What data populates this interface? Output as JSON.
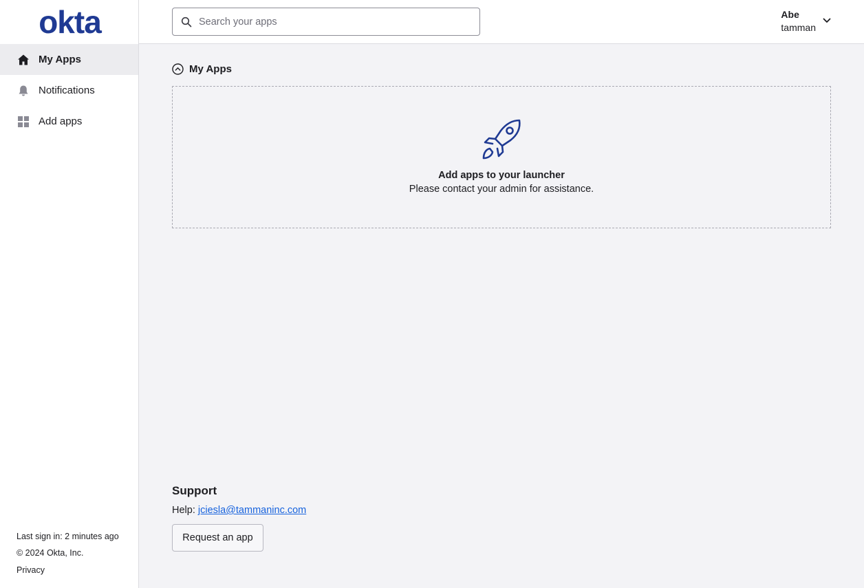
{
  "brand": {
    "logo_text": "okta",
    "color": "#1f3a93"
  },
  "sidebar": {
    "items": [
      {
        "label": "My Apps",
        "icon": "home-icon",
        "active": true
      },
      {
        "label": "Notifications",
        "icon": "bell-icon",
        "active": false
      },
      {
        "label": "Add apps",
        "icon": "grid-icon",
        "active": false
      }
    ],
    "footer": {
      "last_sign_in": "Last sign in: 2 minutes ago",
      "copyright": "© 2024 Okta, Inc.",
      "privacy": "Privacy"
    }
  },
  "header": {
    "search_placeholder": "Search your apps",
    "user_first_name": "Abe",
    "user_org": "tamman"
  },
  "main": {
    "section_title": "My Apps",
    "empty_title": "Add apps to your launcher",
    "empty_subtitle": "Please contact your admin for assistance."
  },
  "support": {
    "title": "Support",
    "help_label": "Help:",
    "help_email": "jciesla@tammaninc.com",
    "request_button": "Request an app"
  },
  "colors": {
    "accent": "#1f3a93",
    "link": "#1662dd",
    "background": "#f3f3f6"
  }
}
